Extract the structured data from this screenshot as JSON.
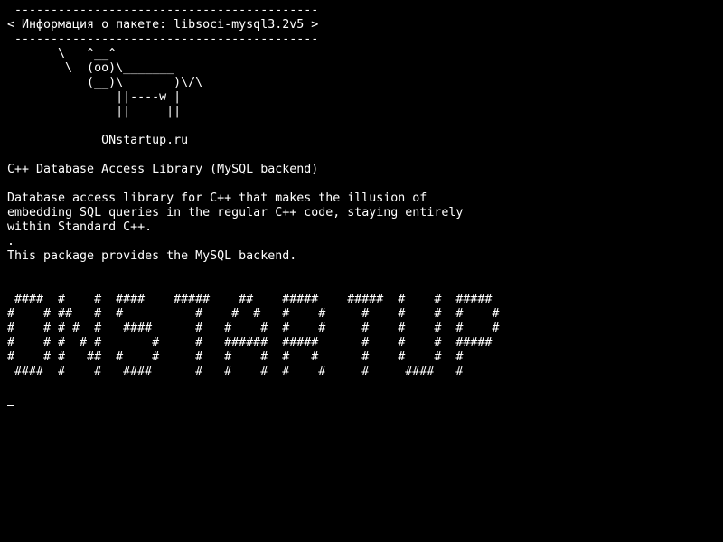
{
  "terminal": {
    "colors": {
      "background": "#000000",
      "foreground": "#ffffff"
    },
    "lines": [
      " ------------------------------------------",
      "< Информация о пакете: libsoci-mysql3.2v5 >",
      " ------------------------------------------",
      "       \\   ^__^",
      "        \\  (oo)\\_______",
      "           (__)\\       )\\/\\",
      "               ||----w |",
      "               ||     ||",
      "",
      "             ONstartup.ru",
      "",
      "C++ Database Access Library (MySQL backend)",
      "",
      "Database access library for C++ that makes the illusion of",
      "embedding SQL queries in the regular C++ code, staying entirely",
      "within Standard C++.",
      ".",
      "This package provides the MySQL backend.",
      "",
      "",
      " ####  #    #  ####    #####    ##    #####    #####  #    #  #####",
      "#    # ##   #  #          #    #  #   #    #     #    #    #  #    #",
      "#    # # #  #   ####      #   #    #  #    #     #    #    #  #    #",
      "#    # #  # #       #     #   ######  #####      #    #    #  #####",
      "#    # #   ##  #    #     #   #    #  #   #      #    #    #  #",
      " ####  #    #   ####      #   #    #  #    #     #     ####   #",
      "",
      ""
    ]
  }
}
